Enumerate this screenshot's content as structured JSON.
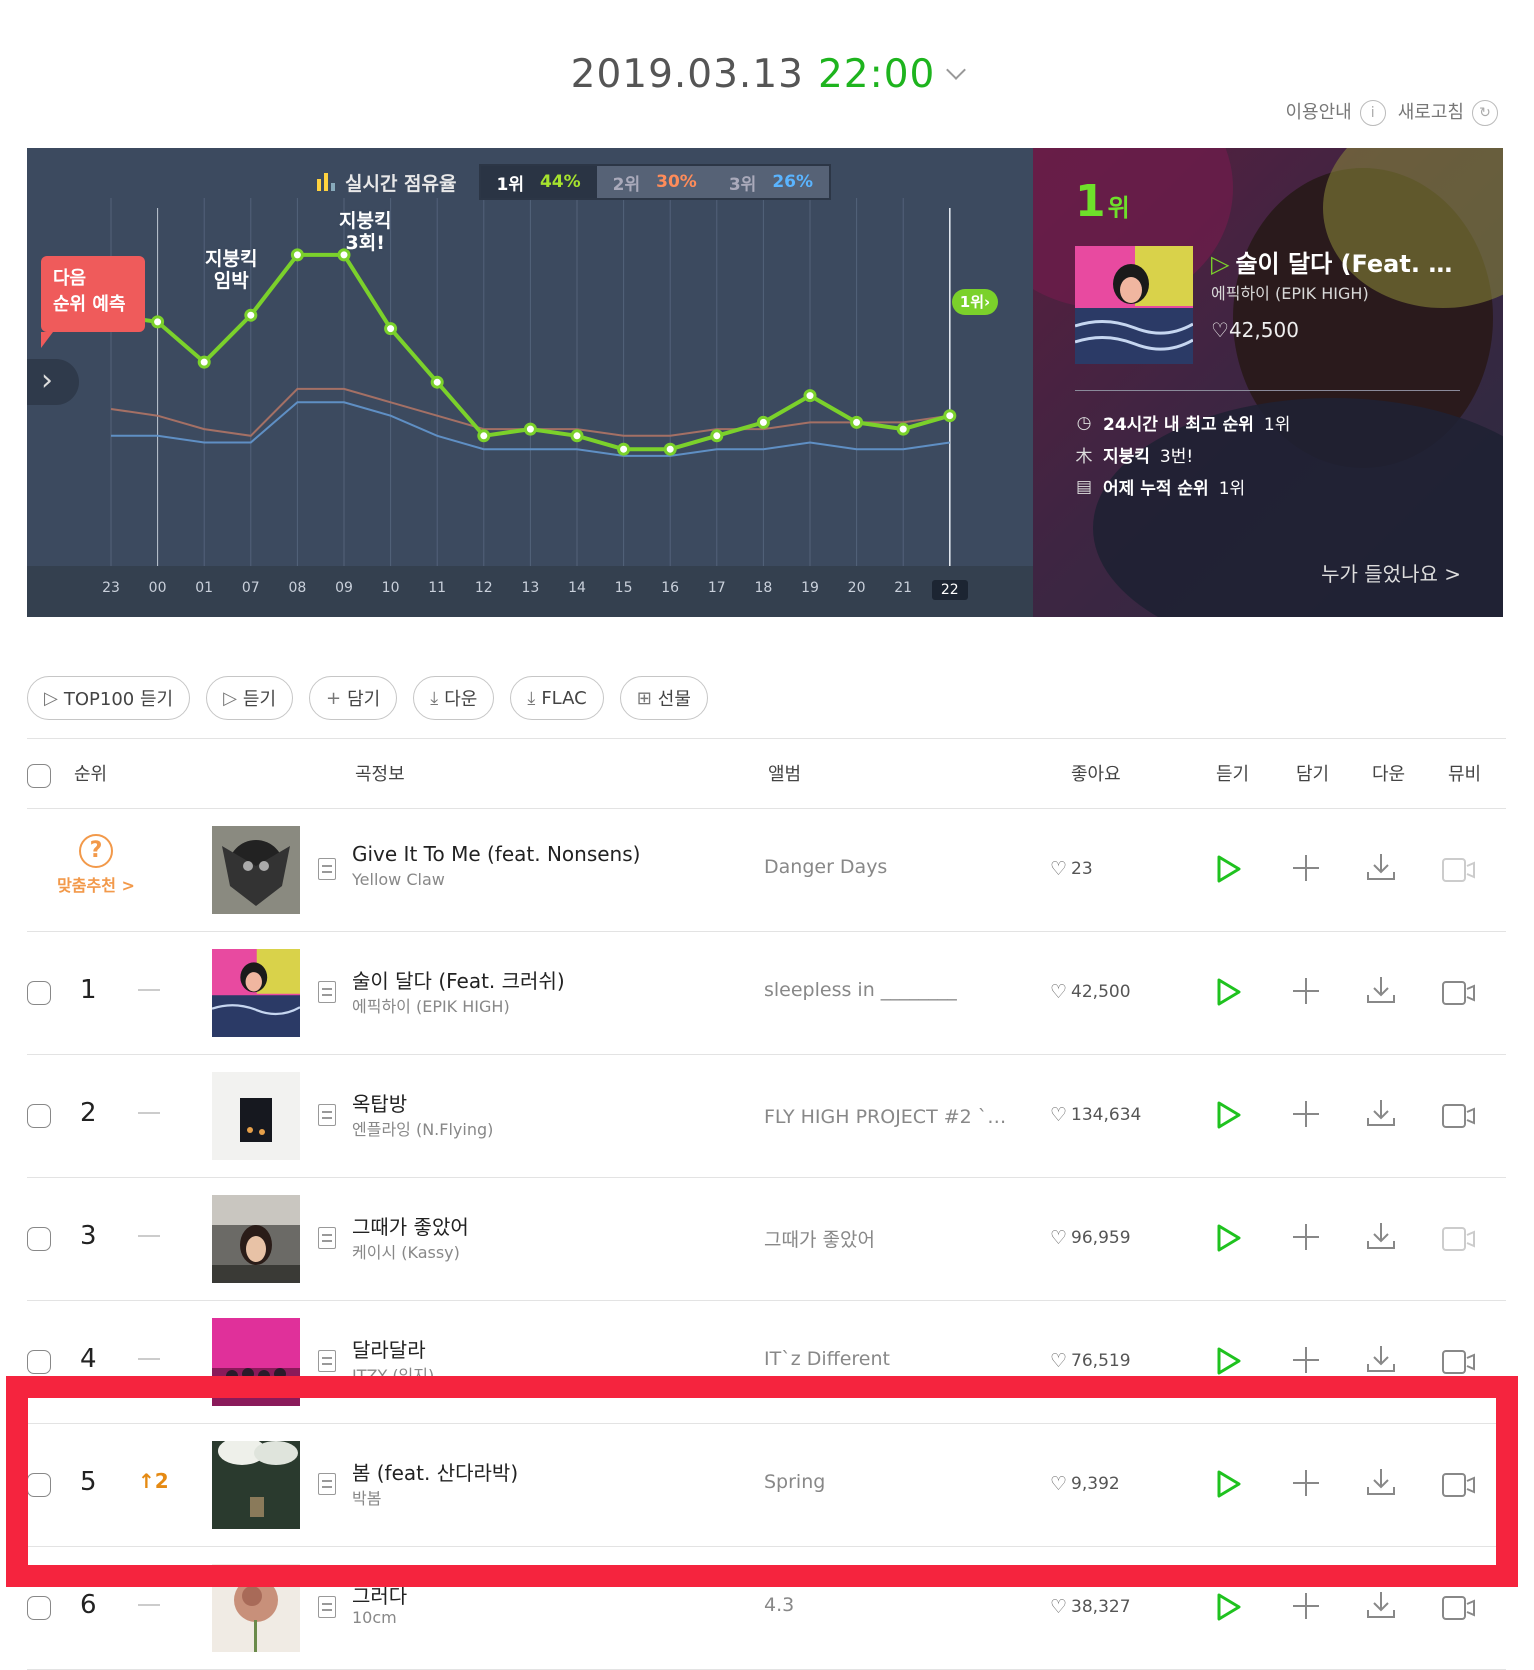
{
  "header": {
    "date": "2019.03.13",
    "time": "22:00"
  },
  "util": {
    "guide": "이용안내",
    "refresh": "새로고침"
  },
  "chart_panel": {
    "share_label": "실시간 점유율",
    "share": [
      {
        "rank": "1위",
        "pct": "44%",
        "color": "#a6e22e"
      },
      {
        "rank": "2위",
        "pct": "30%",
        "color": "#ff8c5a"
      },
      {
        "rank": "3위",
        "pct": "26%",
        "color": "#5ab4ff"
      }
    ],
    "next_rank_predict": "다음\n순위 예측",
    "hours": [
      "23",
      "00",
      "01",
      "07",
      "08",
      "09",
      "10",
      "11",
      "12",
      "13",
      "14",
      "15",
      "16",
      "17",
      "18",
      "19",
      "20",
      "21",
      "22"
    ],
    "current_hour": "22",
    "note_imminent": "지붕킥\n임박",
    "note_roofkick": "지붕킥\n3회!",
    "current_badge": "1위"
  },
  "chart_data": {
    "type": "line",
    "x": [
      "23",
      "00",
      "01",
      "07",
      "08",
      "09",
      "10",
      "11",
      "12",
      "13",
      "14",
      "15",
      "16",
      "17",
      "18",
      "19",
      "20",
      "21",
      "22"
    ],
    "series": [
      {
        "values": [
          44,
          43,
          37,
          44,
          53,
          53,
          42,
          34,
          26,
          27,
          26,
          24,
          24,
          26,
          28,
          32,
          28,
          27,
          29
        ],
        "color": "#7bd12b"
      },
      {
        "values": [
          30,
          29,
          27,
          26,
          33,
          33,
          31,
          29,
          27,
          27,
          27,
          26,
          26,
          27,
          27,
          28,
          28,
          28,
          29
        ],
        "color": "#a47065"
      },
      {
        "values": [
          26,
          26,
          25,
          25,
          31,
          31,
          29,
          26,
          24,
          24,
          24,
          23,
          23,
          24,
          24,
          25,
          24,
          24,
          25
        ],
        "color": "#5f8fc4"
      }
    ],
    "grid": true
  },
  "featured": {
    "rank_num": "1",
    "rank_unit": "위",
    "title": "술이 달다 (Feat. 크러쉬)",
    "artist": "에픽하이 (EPIK HIGH)",
    "likes": "42,500",
    "best24": "24시간 내 최고 순위",
    "best24_val": "1위",
    "roofkick": "지붕킥",
    "roofkick_val": "3번!",
    "yesterday": "어제 누적 순위",
    "yesterday_val": "1위",
    "who_listened": "누가 들었나요 >"
  },
  "actions": [
    "TOP100 듣기",
    "듣기",
    "담기",
    "다운",
    "FLAC",
    "선물"
  ],
  "table": {
    "headers": {
      "rank": "순위",
      "song": "곡정보",
      "album": "앨범",
      "like": "좋아요",
      "play": "듣기",
      "add": "담기",
      "down": "다운",
      "mv": "뮤비"
    },
    "recommend_label": "맞춤추천 >",
    "rows": [
      {
        "rank": "",
        "change": "",
        "title": "Give It To Me (feat. Nonsens)",
        "artist": "Yellow Claw",
        "album": "Danger Days",
        "likes": "23"
      },
      {
        "rank": "1",
        "change": "",
        "title": "술이 달다 (Feat. 크러쉬)",
        "artist": "에픽하이 (EPIK HIGH)",
        "album": "sleepless in ________",
        "likes": "42,500"
      },
      {
        "rank": "2",
        "change": "",
        "title": "옥탑방",
        "artist": "엔플라잉 (N.Flying)",
        "album": "FLY HIGH PROJECT #2 `옥…",
        "likes": "134,634"
      },
      {
        "rank": "3",
        "change": "",
        "title": "그때가 좋았어",
        "artist": "케이시 (Kassy)",
        "album": "그때가 좋았어",
        "likes": "96,959"
      },
      {
        "rank": "4",
        "change": "",
        "title": "달라달라",
        "artist": "ITZY (있지)",
        "album": "IT`z Different",
        "likes": "76,519"
      },
      {
        "rank": "5",
        "change": "2",
        "title": "봄 (feat. 산다라박)",
        "artist": "박봄",
        "album": "Spring",
        "likes": "9,392"
      },
      {
        "rank": "6",
        "change": "",
        "title": "그러다",
        "artist": "10cm",
        "album": "4.3",
        "likes": "38,327"
      }
    ]
  }
}
